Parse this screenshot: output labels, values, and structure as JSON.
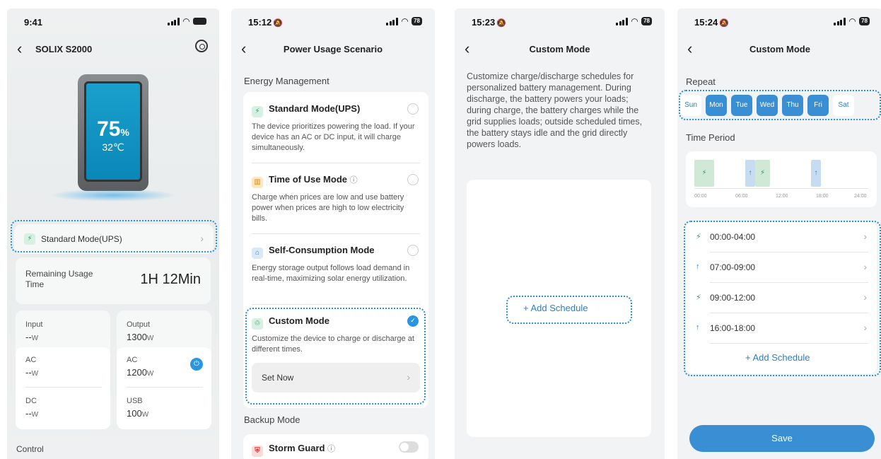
{
  "screen1": {
    "time": "9:41",
    "title": "SOLIX S2000",
    "battery_pct": "75",
    "pct_unit": "%",
    "temp": "32℃",
    "mode_label": "Standard Mode(UPS)",
    "remaining_label": "Remaining Usage Time",
    "remaining_value": "1H 12Min",
    "input": {
      "label": "Input",
      "value": "--",
      "unit": "W"
    },
    "output": {
      "label": "Output",
      "value": "1300",
      "unit": "W"
    },
    "ac_in": {
      "label": "AC",
      "value": "--",
      "unit": "W"
    },
    "dc_in": {
      "label": "DC",
      "value": "--",
      "unit": "W"
    },
    "ac_out": {
      "label": "AC",
      "value": "1200",
      "unit": "W"
    },
    "usb_out": {
      "label": "USB",
      "value": "100",
      "unit": "W"
    },
    "control_label": "Control"
  },
  "screen2": {
    "time": "15:12",
    "battery": "78",
    "title": "Power Usage Scenario",
    "section_energy": "Energy Management",
    "options": [
      {
        "title": "Standard Mode(UPS)",
        "desc": "The device prioritizes powering the load. If your device has an AC or DC input, it will charge simultaneously."
      },
      {
        "title": "Time of Use Mode",
        "desc": "Charge when prices are low and use battery power when prices are high to low electricity bills."
      },
      {
        "title": "Self-Consumption Mode",
        "desc": "Energy storage output follows load demand in real-time, maximizing solar energy utilization."
      },
      {
        "title": "Custom Mode",
        "desc": "Customize the device to charge or discharge at different times."
      }
    ],
    "set_now": "Set Now",
    "section_backup": "Backup Mode",
    "storm_guard": "Storm Guard"
  },
  "screen3": {
    "time": "15:23",
    "battery": "78",
    "title": "Custom Mode",
    "description": "Customize charge/discharge schedules for personalized battery management. During discharge, the battery powers your loads; during charge, the battery charges while the grid supplies loads; outside scheduled times, the battery stays idle and the grid directly powers loads.",
    "add_schedule": "+ Add Schedule"
  },
  "screen4": {
    "time": "15:24",
    "battery": "78",
    "title": "Custom Mode",
    "repeat_label": "Repeat",
    "days": [
      {
        "label": "Sun",
        "on": false
      },
      {
        "label": "Mon",
        "on": true
      },
      {
        "label": "Tue",
        "on": true
      },
      {
        "label": "Wed",
        "on": true
      },
      {
        "label": "Thu",
        "on": true
      },
      {
        "label": "Fri",
        "on": true
      },
      {
        "label": "Sat",
        "on": false
      }
    ],
    "time_period_label": "Time Period",
    "ticks": [
      "00:00",
      "06:00",
      "12:00",
      "18:00",
      "24:00"
    ],
    "schedules": [
      {
        "range": "00:00-04:00",
        "type": "discharge"
      },
      {
        "range": "07:00-09:00",
        "type": "charge"
      },
      {
        "range": "09:00-12:00",
        "type": "discharge"
      },
      {
        "range": "16:00-18:00",
        "type": "charge"
      }
    ],
    "add_schedule": "+ Add Schedule",
    "save": "Save"
  },
  "colors": {
    "accent": "#3a8fd4",
    "highlight": "#2b8fd8",
    "green": "#2a9d5c"
  }
}
